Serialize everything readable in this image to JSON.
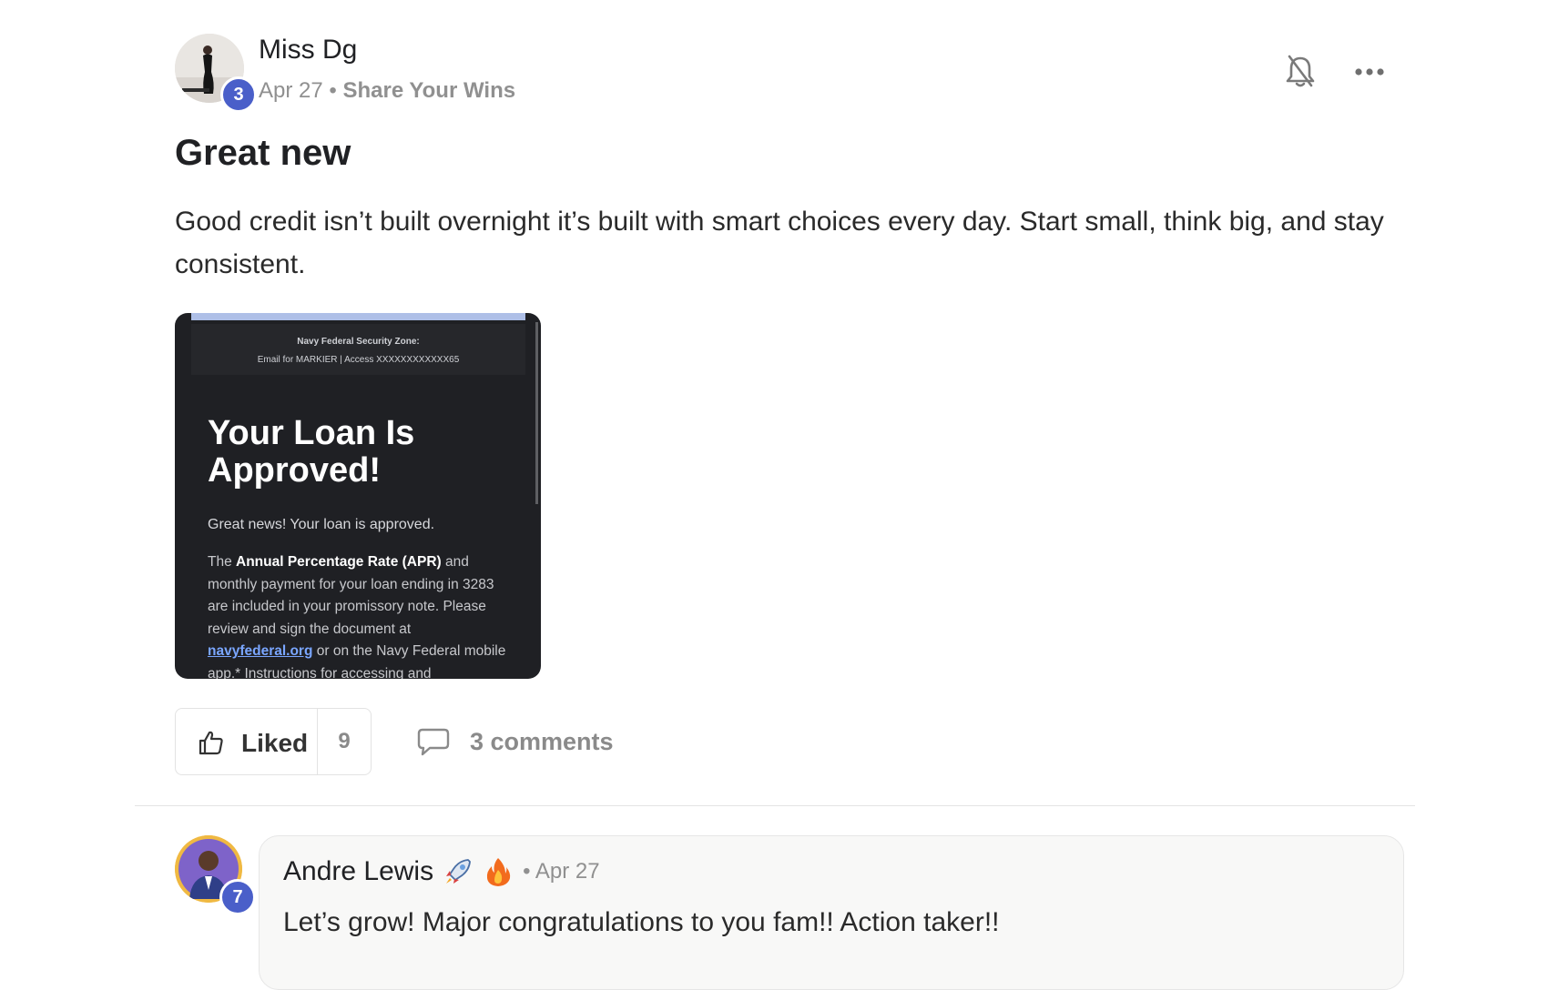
{
  "post": {
    "author": {
      "name": "Miss Dg",
      "level": "3"
    },
    "date": "Apr 27",
    "separator": "•",
    "category": "Share Your Wins",
    "title": "Great new",
    "body": "Good credit isn’t built overnight it’s built with smart choices every day. Start small, think big, and stay consistent.",
    "attachment": {
      "header_line1": "Navy Federal Security Zone:",
      "header_line2": "Email for MARKIER | Access XXXXXXXXXXXX65",
      "headline": "Your Loan Is Approved!",
      "intro": "Great news! Your loan is approved.",
      "para_prefix": "The ",
      "para_bold": "Annual Percentage Rate (APR)",
      "para_mid": " and monthly payment for your loan ending in 3283 are included in your promissory note. Please review and sign the document at ",
      "para_link": "navyfederal.org",
      "para_suffix": " or on the Navy Federal mobile app.* Instructions for accessing and"
    },
    "actions": {
      "like_label": "Liked",
      "like_count": "9",
      "comments_label": "3 comments"
    },
    "icons": {
      "bell": "bell-off-icon",
      "more": "more-horizontal-icon",
      "like": "thumbs-up-icon",
      "comment": "comment-icon"
    },
    "colors": {
      "level_badge": "#4a5fc9",
      "muted_text": "#909090",
      "attachment_bg": "#1f2024"
    }
  },
  "comment": {
    "author": "Andre Lewis",
    "emojis": [
      "rocket-emoji",
      "fire-emoji"
    ],
    "level": "7",
    "separator": "•",
    "date": "Apr 27",
    "text": "Let’s grow! Major congratulations to you fam!! Action taker!!"
  }
}
